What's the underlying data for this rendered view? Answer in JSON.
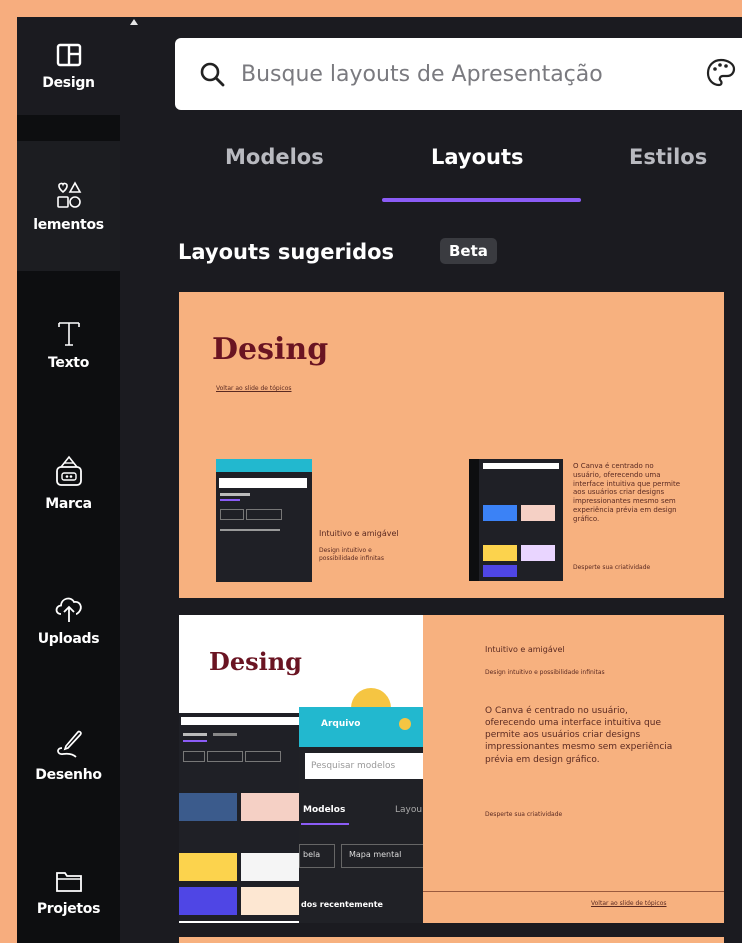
{
  "rail": {
    "items": [
      {
        "label": "Design",
        "icon": "layout-icon"
      },
      {
        "label": "lementos",
        "icon": "elements-icon"
      },
      {
        "label": "Texto",
        "icon": "text-icon"
      },
      {
        "label": "Marca",
        "icon": "brand-icon"
      },
      {
        "label": "Uploads",
        "icon": "upload-icon"
      },
      {
        "label": "Desenho",
        "icon": "draw-icon"
      },
      {
        "label": "Projetos",
        "icon": "folder-icon"
      }
    ]
  },
  "search": {
    "placeholder": "Busque layouts de Apresentação",
    "icon": "search-icon",
    "extra_icon": "palette-icon"
  },
  "tabs": [
    {
      "label": "Modelos",
      "active": false
    },
    {
      "label": "Layouts",
      "active": true
    },
    {
      "label": "Estilos",
      "active": false
    }
  ],
  "section": {
    "title": "Layouts sugeridos",
    "badge": "Beta"
  },
  "cards": [
    {
      "title": "Desing",
      "link": "Voltar ao slide de tópicos",
      "left_caption": "Intuitivo e amigável",
      "left_sub": "Design intuitivo e possibilidade infinitas",
      "right_body": "O Canva é centrado no usuário, oferecendo uma interface intuitiva que permite aos usuários criar designs impressionantes mesmo sem experiência prévia em design gráfico.",
      "right_cta": "Desperte sua criatividade"
    },
    {
      "title": "Desing",
      "heading": "Intuitivo e amigável",
      "sub": "Design intuitivo e possibilidade infinitas",
      "body": "O Canva é centrado no usuário, oferecendo uma interface intuitiva que permite aos usuários criar designs impressionantes mesmo sem experiência prévia em design gráfico.",
      "cta": "Desperte sua criatividade",
      "link": "Voltar ao slide de tópicos",
      "screenshot": {
        "arquivo": "Arquivo",
        "search": "Pesquisar modelos",
        "tab1": "Modelos",
        "tab2": "Layou",
        "chip1": "bela",
        "chip2": "Mapa mental",
        "recent": "dos recentemente"
      }
    }
  ],
  "colors": {
    "accent": "#8b5cf6",
    "peach": "#f7b17f",
    "title_red": "#6a1422",
    "panel": "#1b1b20"
  }
}
